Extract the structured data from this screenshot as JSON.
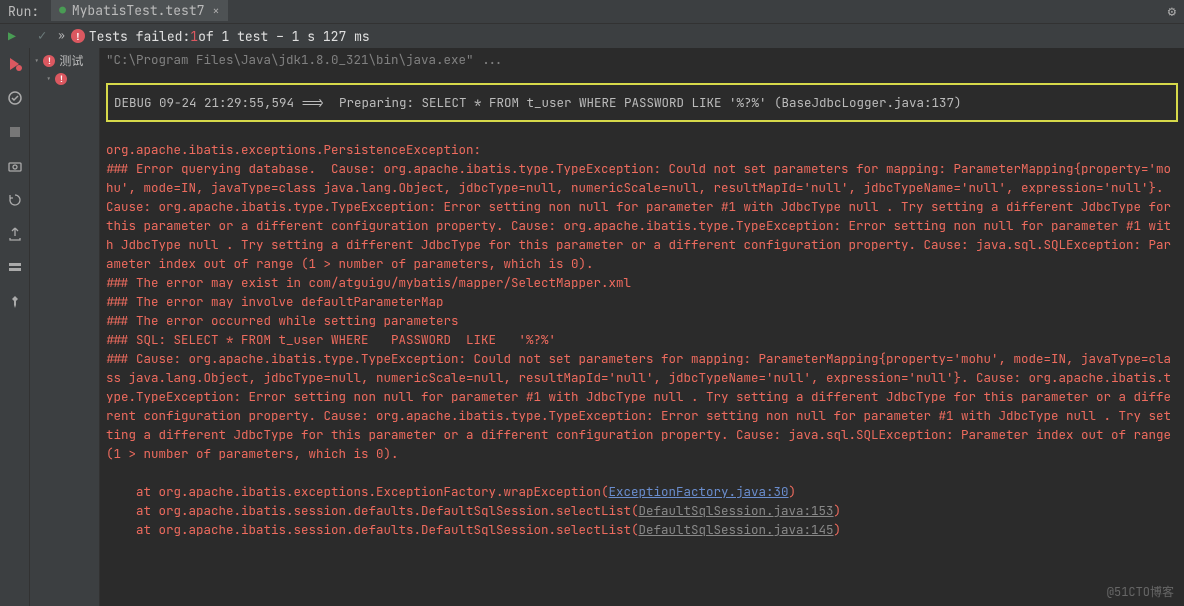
{
  "titlebar": {
    "runLabel": "Run:",
    "tabIcon": "●",
    "tabTitle": "MybatisTest.test7",
    "tabClose": "×",
    "gear": "⚙"
  },
  "statusbar": {
    "check": "✓",
    "chev": "»",
    "failmark": "!",
    "failPrefix": "Tests failed:",
    "failCount": " 1 ",
    "failSuffix": "of 1 test – 1 s 127 ms"
  },
  "tree": {
    "r1exp": "▾",
    "r1err": "!",
    "r1label": "测试",
    "r2exp": "▾",
    "r2err": "!"
  },
  "console": {
    "path": "\"C:\\Program Files\\Java\\jdk1.8.0_321\\bin\\java.exe\" ...",
    "debugLine": "DEBUG 09-24 21:29:55,594 ==>  Preparing: SELECT * FROM t_user WHERE PASSWORD LIKE '%?%' (BaseJdbcLogger.java:137)",
    "err1": "org.apache.ibatis.exceptions.PersistenceException: ",
    "err2": "### Error querying database.  Cause: org.apache.ibatis.type.TypeException: Could not set parameters for mapping: ParameterMapping{property='mohu', mode=IN, javaType=class java.lang.Object, jdbcType=null, numericScale=null, resultMapId='null', jdbcTypeName='null', expression='null'}. Cause: org.apache.ibatis.type.TypeException: Error setting non null for parameter #1 with JdbcType null . Try setting a different JdbcType for this parameter or a different configuration property. Cause: org.apache.ibatis.type.TypeException: Error setting non null for parameter #1 with JdbcType null . Try setting a different JdbcType for this parameter or a different configuration property. Cause: java.sql.SQLException: Parameter index out of range (1 > number of parameters, which is 0).",
    "err3": "### The error may exist in com/atguigu/mybatis/mapper/SelectMapper.xml",
    "err4": "### The error may involve defaultParameterMap",
    "err5": "### The error occurred while setting parameters",
    "err6": "### SQL: SELECT * FROM t_user WHERE   PASSWORD  LIKE   '%?%'",
    "err7": "### Cause: org.apache.ibatis.type.TypeException: Could not set parameters for mapping: ParameterMapping{property='mohu', mode=IN, javaType=class java.lang.Object, jdbcType=null, numericScale=null, resultMapId='null', jdbcTypeName='null', expression='null'}. Cause: org.apache.ibatis.type.TypeException: Error setting non null for parameter #1 with JdbcType null . Try setting a different JdbcType for this parameter or a different configuration property. Cause: org.apache.ibatis.type.TypeException: Error setting non null for parameter #1 with JdbcType null . Try setting a different JdbcType for this parameter or a different configuration property. Cause: java.sql.SQLException: Parameter index out of range (1 > number of parameters, which is 0).",
    "st1a": "    at org.apache.ibatis.exceptions.ExceptionFactory.wrapException(",
    "st1b": "ExceptionFactory.java:30",
    "st1c": ")",
    "st2a": "    at org.apache.ibatis.session.defaults.DefaultSqlSession.selectList(",
    "st2b": "DefaultSqlSession.java:153",
    "st2c": ")",
    "st3a": "    at org.apache.ibatis.session.defaults.DefaultSqlSession.selectList(",
    "st3b": "DefaultSqlSession.java:145",
    "st3c": ")"
  },
  "watermark": "@51CTO博客"
}
